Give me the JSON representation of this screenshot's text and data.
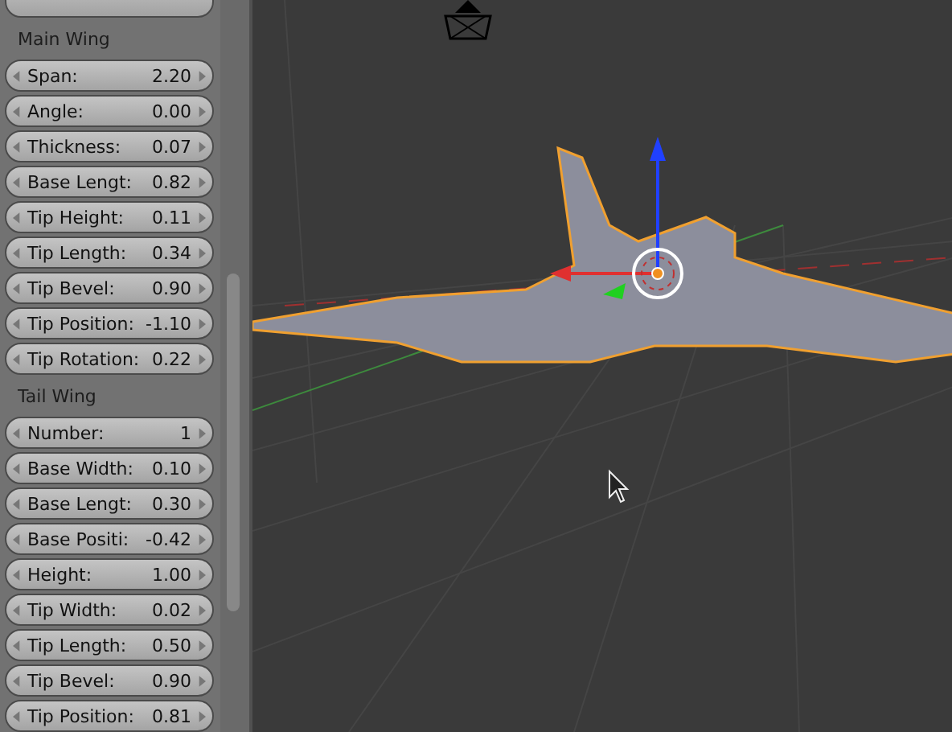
{
  "sections": [
    {
      "title": "Main Wing",
      "fields": [
        {
          "label": "Span:",
          "value": "2.20"
        },
        {
          "label": "Angle:",
          "value": "0.00"
        },
        {
          "label": "Thickness:",
          "value": "0.07"
        },
        {
          "label": "Base Lengt:",
          "value": "0.82"
        },
        {
          "label": "Tip Height:",
          "value": "0.11"
        },
        {
          "label": "Tip Length:",
          "value": "0.34"
        },
        {
          "label": "Tip Bevel:",
          "value": "0.90"
        },
        {
          "label": "Tip Position:",
          "value": "-1.10"
        },
        {
          "label": "Tip Rotation:",
          "value": "0.22"
        }
      ]
    },
    {
      "title": "Tail Wing",
      "fields": [
        {
          "label": "Number:",
          "value": "1"
        },
        {
          "label": "Base Width:",
          "value": "0.10"
        },
        {
          "label": "Base Lengt:",
          "value": "0.30"
        },
        {
          "label": "Base Positi:",
          "value": "-0.42"
        },
        {
          "label": "Height:",
          "value": "1.00"
        },
        {
          "label": "Tip Width:",
          "value": "0.02"
        },
        {
          "label": "Tip Length:",
          "value": "0.50"
        },
        {
          "label": "Tip Bevel:",
          "value": "0.90"
        },
        {
          "label": "Tip Position:",
          "value": "0.81"
        }
      ]
    }
  ]
}
